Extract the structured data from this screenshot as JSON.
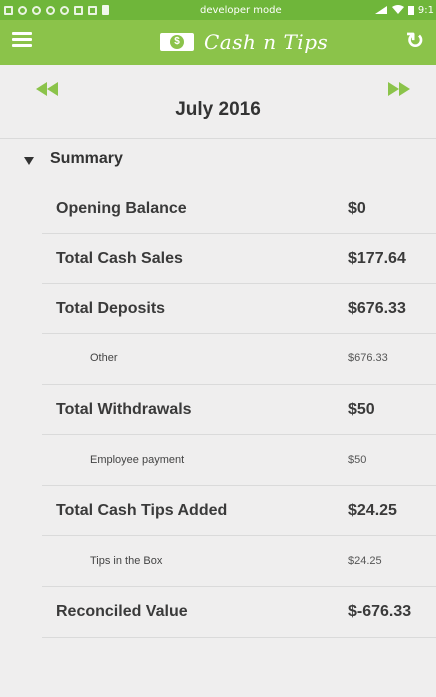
{
  "status_bar": {
    "center_text": "developer mode",
    "time": "9:1",
    "left_icons": [
      "app-icon",
      "circle-icon",
      "circle-icon",
      "circle-icon",
      "shield-icon",
      "list-icon",
      "square-icon",
      "battery-icon"
    ],
    "right_icons": [
      "signal-icon",
      "wifi-icon",
      "battery-icon"
    ]
  },
  "app_bar": {
    "title": "Cash n Tips",
    "logo_symbol": "$",
    "menu_icon": "hamburger-menu-icon",
    "refresh_icon": "refresh-icon",
    "background_color": "#8bc34a"
  },
  "month_nav": {
    "label": "July 2016",
    "prev_icon": "rewind-icon",
    "next_icon": "fast-forward-icon"
  },
  "summary": {
    "header": "Summary",
    "rows": [
      {
        "label": "Opening Balance",
        "value": "$0",
        "kind": "main"
      },
      {
        "label": "Total Cash Sales",
        "value": "$177.64",
        "kind": "main"
      },
      {
        "label": "Total Deposits",
        "value": "$676.33",
        "kind": "main"
      },
      {
        "label": "Other",
        "value": "$676.33",
        "kind": "sub"
      },
      {
        "label": "Total Withdrawals",
        "value": "$50",
        "kind": "main"
      },
      {
        "label": "Employee payment",
        "value": "$50",
        "kind": "sub"
      },
      {
        "label": "Total Cash Tips Added",
        "value": "$24.25",
        "kind": "main"
      },
      {
        "label": "Tips in the Box",
        "value": "$24.25",
        "kind": "sub"
      },
      {
        "label": "Reconciled Value",
        "value": "$-676.33",
        "kind": "main"
      }
    ]
  }
}
